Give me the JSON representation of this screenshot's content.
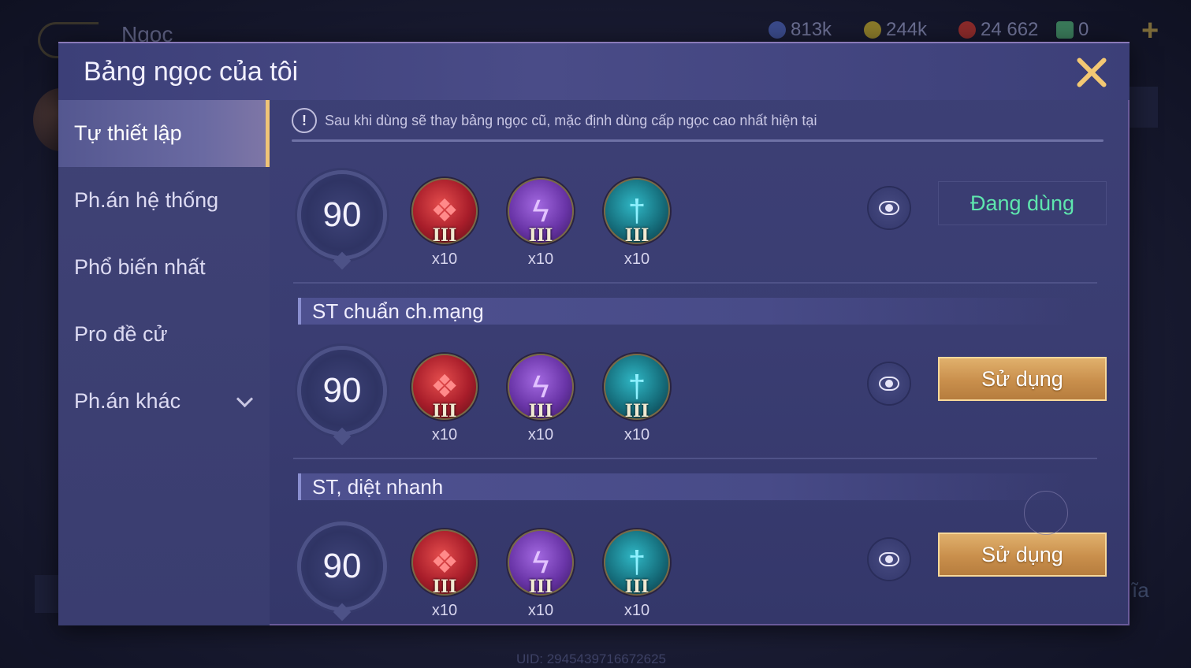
{
  "background": {
    "title": "Ngọc",
    "resources": [
      {
        "icon": "gem-currency-icon",
        "value": "813k",
        "color": "#3a4a8a"
      },
      {
        "icon": "gold-coin-icon",
        "value": "244k",
        "color": "#8a7a2a"
      },
      {
        "icon": "ruby-icon",
        "value": "24 662",
        "color": "#8a2a2a"
      },
      {
        "icon": "ticket-icon",
        "value": "0",
        "color": "#3a7a5a"
      }
    ],
    "uid": "UID: 2945439716672625"
  },
  "modal": {
    "title": "Bảng ngọc của tôi",
    "sidebar": {
      "items": [
        {
          "label": "Tự thiết lập",
          "active": true
        },
        {
          "label": "Ph.án hệ thống",
          "active": false
        },
        {
          "label": "Phổ biến nhất",
          "active": false
        },
        {
          "label": "Pro đề cử",
          "active": false
        },
        {
          "label": "Ph.án khác",
          "active": false,
          "dropdown": true
        }
      ]
    },
    "notice": "Sau khi dùng sẽ thay bảng ngọc cũ, mặc định dùng cấp ngọc cao nhất hiện tại",
    "sets": [
      {
        "name": "",
        "level": "90",
        "gems": [
          {
            "color": "red",
            "icon": "red-sword-gem-icon",
            "tier": "III",
            "count": "x10"
          },
          {
            "color": "purple",
            "icon": "purple-lightning-gem-icon",
            "tier": "III",
            "count": "x10"
          },
          {
            "color": "teal",
            "icon": "teal-dagger-gem-icon",
            "tier": "III",
            "count": "x10"
          }
        ],
        "action": "Đang dùng",
        "in_use": true
      },
      {
        "name": "ST chuẩn ch.mạng",
        "level": "90",
        "gems": [
          {
            "color": "red",
            "icon": "red-sword-gem-icon",
            "tier": "III",
            "count": "x10"
          },
          {
            "color": "purple",
            "icon": "purple-lightning-gem-icon",
            "tier": "III",
            "count": "x10"
          },
          {
            "color": "teal",
            "icon": "teal-dagger-gem-icon",
            "tier": "III",
            "count": "x10"
          }
        ],
        "action": "Sử dụng",
        "in_use": false
      },
      {
        "name": "ST, diệt nhanh",
        "level": "90",
        "gems": [
          {
            "color": "red",
            "icon": "red-sword-gem-icon",
            "tier": "III",
            "count": "x10"
          },
          {
            "color": "purple",
            "icon": "purple-lightning-gem-icon",
            "tier": "III",
            "count": "x10"
          },
          {
            "color": "teal",
            "icon": "teal-dagger-gem-icon",
            "tier": "III",
            "count": "x10"
          }
        ],
        "action": "Sử dụng",
        "in_use": false
      }
    ]
  }
}
